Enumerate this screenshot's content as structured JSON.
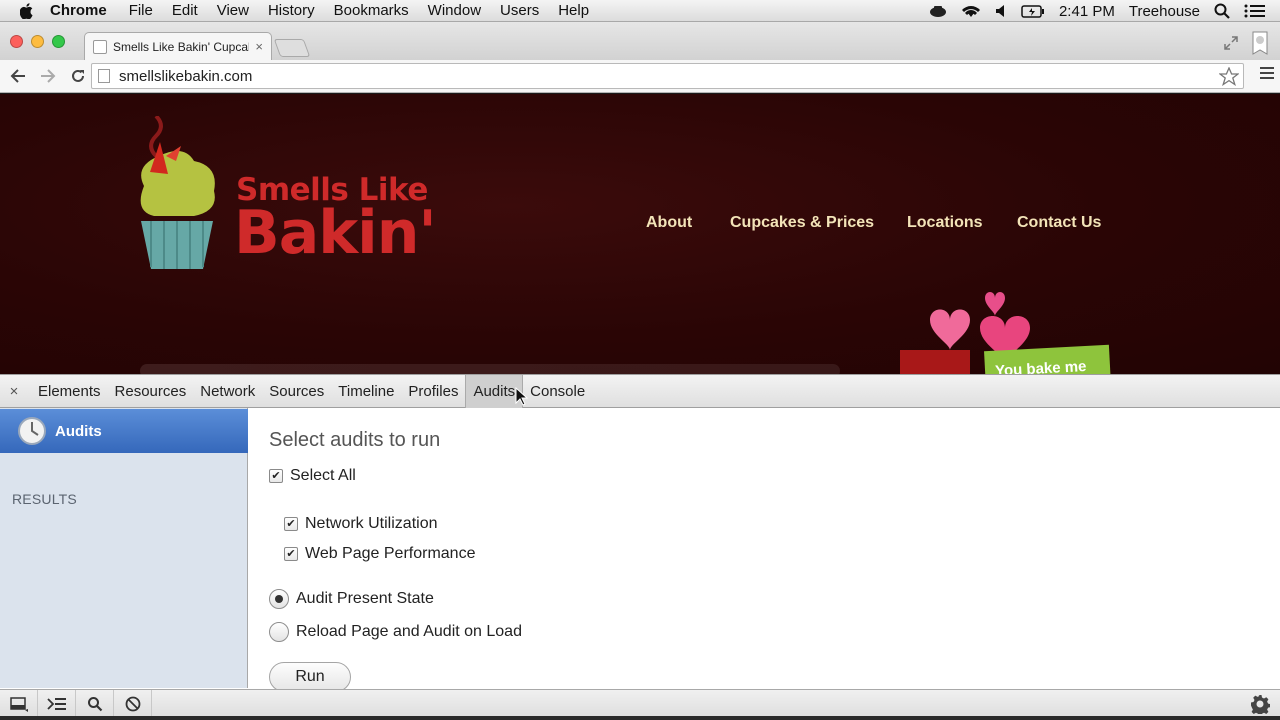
{
  "menubar": {
    "app": "Chrome",
    "items": [
      "File",
      "Edit",
      "View",
      "History",
      "Bookmarks",
      "Window",
      "Users",
      "Help"
    ],
    "clock": "2:41 PM",
    "user": "Treehouse"
  },
  "browser": {
    "tab_title": "Smells Like Bakin' Cupcake",
    "tab_close": "×",
    "url": "smellslikebakin.com"
  },
  "site": {
    "logo_line1": "Smells Like",
    "logo_line2": "Bakin'",
    "nav": [
      "About",
      "Cupcakes & Prices",
      "Locations",
      "Contact Us"
    ],
    "banner": "You bake me"
  },
  "devtools": {
    "close": "×",
    "tabs": [
      "Elements",
      "Resources",
      "Network",
      "Sources",
      "Timeline",
      "Profiles",
      "Audits",
      "Console"
    ],
    "selected_tab": "Audits",
    "sidebar_title": "Audits",
    "sidebar_results": "RESULTS",
    "heading": "Select audits to run",
    "select_all": {
      "label": "Select All",
      "checked": true
    },
    "categories": [
      {
        "label": "Network Utilization",
        "checked": true
      },
      {
        "label": "Web Page Performance",
        "checked": true
      }
    ],
    "modes": [
      {
        "label": "Audit Present State",
        "selected": true
      },
      {
        "label": "Reload Page and Audit on Load",
        "selected": false
      }
    ],
    "run_label": "Run"
  },
  "colors": {
    "site_bg": "#2a0505",
    "logo_red": "#cf2a2a",
    "nav_text": "#f3e4b8",
    "sidebar_selected": "#3568bb",
    "sidebar_bg": "#dbe3ed"
  }
}
